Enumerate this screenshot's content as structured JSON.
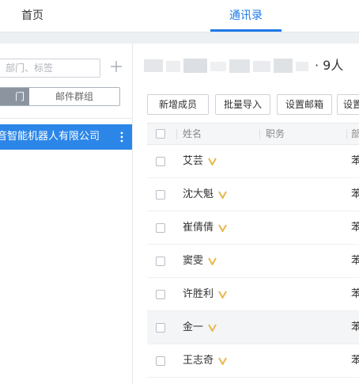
{
  "nav": {
    "home": "首页",
    "contacts": "通讯录"
  },
  "sidebar": {
    "search_placeholder": "部门、标签",
    "seg_left": "门",
    "seg_right": "邮件群组",
    "org_name": "音智能机器人有限公司"
  },
  "main": {
    "member_count": "· 9人",
    "buttons": [
      "新增成员",
      "批量导入",
      "设置邮箱",
      "设置"
    ],
    "columns": {
      "name": "姓名",
      "title": "职务",
      "dept": "部"
    },
    "rows": [
      {
        "name": "艾芸",
        "dept": "苯"
      },
      {
        "name": "沈大魁",
        "dept": "苯"
      },
      {
        "name": "崔倩倩",
        "dept": "苯"
      },
      {
        "name": "窦雯",
        "dept": "苯"
      },
      {
        "name": "许胜利",
        "dept": "苯"
      },
      {
        "name": "金一",
        "dept": "苯"
      },
      {
        "name": "王志奇",
        "dept": "苯"
      }
    ]
  },
  "colors": {
    "accent": "#1f7ae8",
    "selected_bg": "#2b86e8",
    "vip_badge": "#e8b84a"
  }
}
